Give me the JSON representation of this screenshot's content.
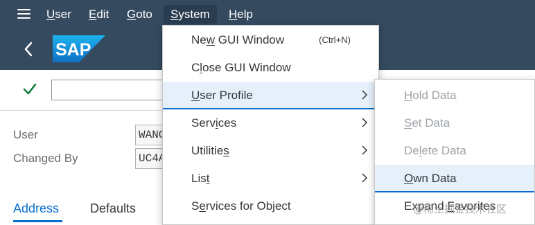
{
  "menubar": {
    "items": [
      {
        "label": "User",
        "accel": "U",
        "rest": "ser"
      },
      {
        "label": "Edit",
        "accel": "E",
        "rest": "dit"
      },
      {
        "label": "Goto",
        "accel": "G",
        "rest": "oto"
      },
      {
        "label": "System",
        "accel": "S",
        "rest": "ystem"
      },
      {
        "label": "Help",
        "accel": "H",
        "rest": "elp"
      }
    ]
  },
  "header": {
    "logo_text": "SAP"
  },
  "form": {
    "fields": [
      {
        "label": "User",
        "value": "WANG"
      },
      {
        "label": "Changed By",
        "value": "UC4A"
      }
    ]
  },
  "tabs": [
    {
      "label": "Address"
    },
    {
      "label": "Defaults"
    }
  ],
  "system_menu": {
    "items": [
      {
        "pre": "Ne",
        "accel": "w",
        "post": " GUI Window",
        "shortcut": "(Ctrl+N)",
        "has_submenu": false
      },
      {
        "pre": "C",
        "accel": "l",
        "post": "ose GUI Window",
        "shortcut": "",
        "has_submenu": false
      },
      {
        "pre": "",
        "accel": "U",
        "post": "ser Profile",
        "shortcut": "",
        "has_submenu": true
      },
      {
        "pre": "Serv",
        "accel": "i",
        "post": "ces",
        "shortcut": "",
        "has_submenu": true
      },
      {
        "pre": "Utilitie",
        "accel": "s",
        "post": "",
        "shortcut": "",
        "has_submenu": true
      },
      {
        "pre": "Lis",
        "accel": "t",
        "post": "",
        "shortcut": "",
        "has_submenu": true
      },
      {
        "pre": "S",
        "accel": "e",
        "post": "rvices for Object",
        "shortcut": "",
        "has_submenu": false
      }
    ]
  },
  "user_profile_submenu": {
    "items": [
      {
        "pre": "",
        "accel": "H",
        "post": "old Data",
        "enabled": false
      },
      {
        "pre": "",
        "accel": "S",
        "post": "et Data",
        "enabled": false
      },
      {
        "pre": "De",
        "accel": "l",
        "post": "ete Data",
        "enabled": false
      },
      {
        "pre": "",
        "accel": "O",
        "post": "wn Data",
        "enabled": true
      },
      {
        "pre": "Expand ",
        "accel": "F",
        "post": "avorites",
        "enabled": true
      }
    ]
  },
  "watermark": "@稀土掘金技术社区",
  "colors": {
    "shell": "#354a5f",
    "accent": "#0a6ed1",
    "highlight": "#e5f0fa",
    "check": "#107e3e",
    "disabled_text": "#9ea3a8"
  }
}
